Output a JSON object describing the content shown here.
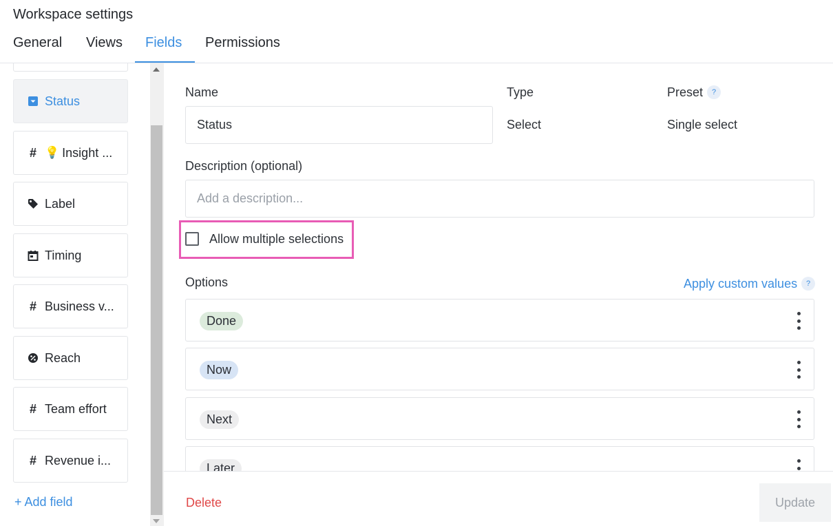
{
  "header": {
    "title": "Workspace settings"
  },
  "tabs": [
    {
      "label": "General"
    },
    {
      "label": "Views"
    },
    {
      "label": "Fields",
      "active": true
    },
    {
      "label": "Permissions"
    }
  ],
  "sidebar": {
    "fields": [
      {
        "label": "Status",
        "icon": "dropdown-square-icon",
        "selected": true
      },
      {
        "label": "Insight ...",
        "icon": "hash-icon",
        "emoji": "💡"
      },
      {
        "label": "Label",
        "icon": "tag-icon"
      },
      {
        "label": "Timing",
        "icon": "calendar-icon"
      },
      {
        "label": "Business v...",
        "icon": "hash-icon"
      },
      {
        "label": "Reach",
        "icon": "percent-circle-icon"
      },
      {
        "label": "Team effort",
        "icon": "hash-icon"
      },
      {
        "label": "Revenue i...",
        "icon": "hash-icon"
      }
    ],
    "add_field": "+ Add field"
  },
  "editor": {
    "name_label": "Name",
    "name_value": "Status",
    "type_label": "Type",
    "type_value": "Select",
    "preset_label": "Preset",
    "preset_help": "?",
    "preset_value": "Single select",
    "description_label": "Description (optional)",
    "description_placeholder": "Add a description...",
    "allow_multiple_label": "Allow multiple selections",
    "allow_multiple_checked": false,
    "options_label": "Options",
    "apply_custom_values": "Apply custom values",
    "apply_help": "?",
    "options": [
      {
        "label": "Done",
        "color": "#dcebdc"
      },
      {
        "label": "Now",
        "color": "#d7e4f5"
      },
      {
        "label": "Next",
        "color": "#ededee"
      },
      {
        "label": "Later",
        "color": "#ededee"
      }
    ]
  },
  "footer": {
    "delete_label": "Delete",
    "update_label": "Update"
  },
  "colors": {
    "accent": "#3d8fe0",
    "danger": "#e04848",
    "highlight": "#e85cb5"
  }
}
